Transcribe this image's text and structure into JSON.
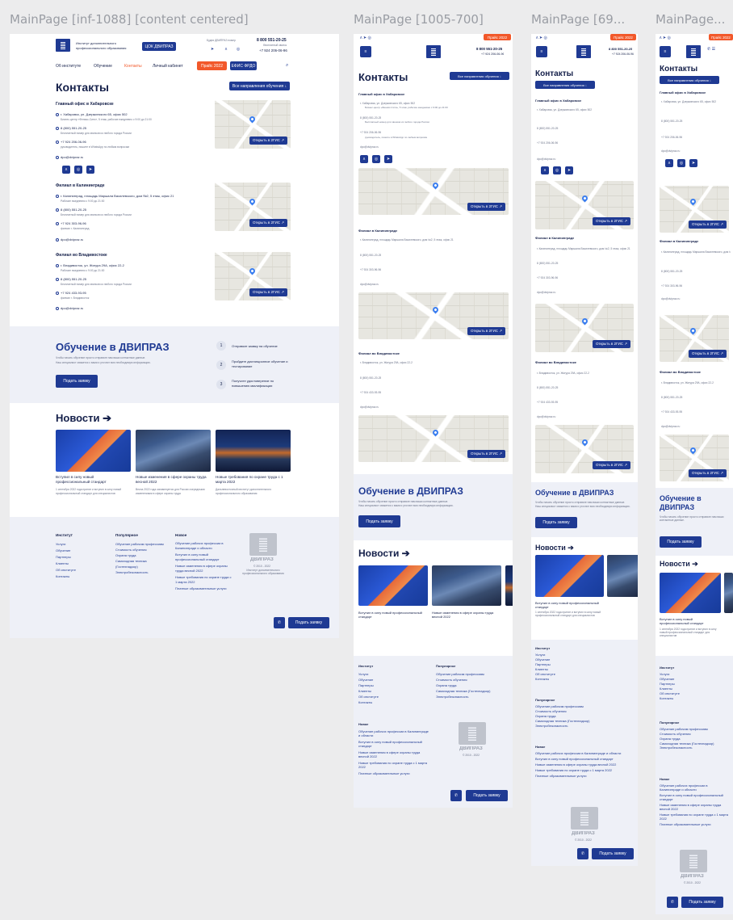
{
  "frame_labels": [
    "MainPage [inf-1088] [content centered]",
    "MainPage [1005-700]",
    "MainPage [69...",
    "MainPage..."
  ],
  "header": {
    "logo_text": "Институт дополнительного профессионального образования",
    "edu_button": "ЦОК ДВИПРАЗ",
    "free_call": "Будни ДВИПРАЗ номер",
    "phone": "8 800 551-20-25",
    "phone_note": "бесплатный звонок",
    "phone2": "+7 924 206-06-96",
    "promo_badge": "Прайс 2022",
    "nav": [
      "Об институте",
      "Обучение",
      "Контакты",
      "Личный кабинет"
    ],
    "nav_active": 2,
    "price_button": "Прайс 2022",
    "esia_button": "ЕФИС ФРДО"
  },
  "title": "Контакты",
  "all_directions": "Все направления обучения ↓",
  "offices": [
    {
      "name": "Главный офис в Хабаровске",
      "address": "г. Хабаровск, ул. Дзержинского 65, офис 502",
      "address_note": "Бизнес-центр «Феникс-Сити», 5 этаж, рабочие ежедневно с 9:00 до 21:00",
      "phone": "8 (800) 551-20-25",
      "phone_note": "Бесплатный номер для звонков из любого города России",
      "mobile": "+7 924 206-06-96",
      "mobile_note": "руководитель, пишите в WhatsApp по любым вопросам",
      "email": "dpo@dvipraz.ru"
    },
    {
      "name": "Филиал в Калининграде",
      "address": "г. Калининград, площадь Маршала Василевского, дом №2, 5 этаж, офис 21",
      "address_note": "Рабочие ежедневно с 9:00 до 21:00",
      "phone": "8 (800) 551-20-25",
      "phone_note": "Бесплатный номер для звонков из любого города России",
      "mobile": "+7 924 303-96-96",
      "mobile_note": "филиал г. Калининград",
      "email": "dpo@dvipraz.ru"
    },
    {
      "name": "Филиал во Владивостоке",
      "address": "г. Владивосток, ул. Жигура 29А, офис 22-2",
      "address_note": "Рабочие ежедневно с 9:00 до 21:00",
      "phone": "8 (800) 551-20-25",
      "phone_note": "Бесплатный номер для звонков из любого города России",
      "mobile": "+7 924 433-93-95",
      "mobile_note": "филиал г. Владивосток",
      "email": "dpo@dvipraz.ru"
    }
  ],
  "map_button": "Открыть в 2ГИС ↗",
  "training": {
    "title": "Обучение в ДВИПРАЗ",
    "text1": "Чтобы начать обучение просто отправьте нам ваши контактные данные.",
    "text2": "Наш специалист свяжется с вами и уточнит всю необходимую информацию.",
    "button": "Подать заявку",
    "steps": [
      {
        "n": "1",
        "text": "Отправьте заявку на обучение"
      },
      {
        "n": "2",
        "text": "Пройдите дистанционное обучение и тестирование"
      },
      {
        "n": "3",
        "text": "Получите удостоверение по повышению квалификации"
      }
    ]
  },
  "news": {
    "title": "Новости",
    "items": [
      {
        "title": "Вступил в силу новый профессиональный стандарт",
        "text": "1 сентября 2022 года принят и вступил в силу новый профессиональный стандарт для специалистов"
      },
      {
        "title": "Новые изменения в сфере охраны труда весной 2022",
        "text": "Весна 2022 года ознаменуется для России очередными изменениями в сфере охраны труда"
      },
      {
        "title": "Новые требования по охране труда с 1 марта 2022",
        "text": "Дальневосточный институт дополнительного профессионального образования"
      }
    ]
  },
  "footer": {
    "cols": [
      {
        "title": "Институт",
        "items": [
          "Услуги",
          "Обучение",
          "Партнеры",
          "Клиенты",
          "Об институте",
          "Контакты"
        ]
      },
      {
        "title": "Популярное",
        "items": [
          "Обучение рабочим профессиям",
          "Стоимость обучения",
          "Охрана труда",
          "Самоходная техника (Гостехнадзор)",
          "Электробезопасность"
        ]
      },
      {
        "title": "Новое",
        "items": [
          "Обучение рабочих профессии в Калининграде и области",
          "Вступил в силу новый профессиональный стандарт",
          "Новые изменения в сфере охраны труда весной 2022",
          "Новые требования по охране труда с 1 марта 2022",
          "Платные образовательные услуги"
        ]
      }
    ],
    "brand": "ДВИПРАЗ",
    "copyright": "© 2010 - 2022",
    "brand_sub": "Институт дополнительного профессионального образования",
    "apply": "Подать заявку"
  }
}
